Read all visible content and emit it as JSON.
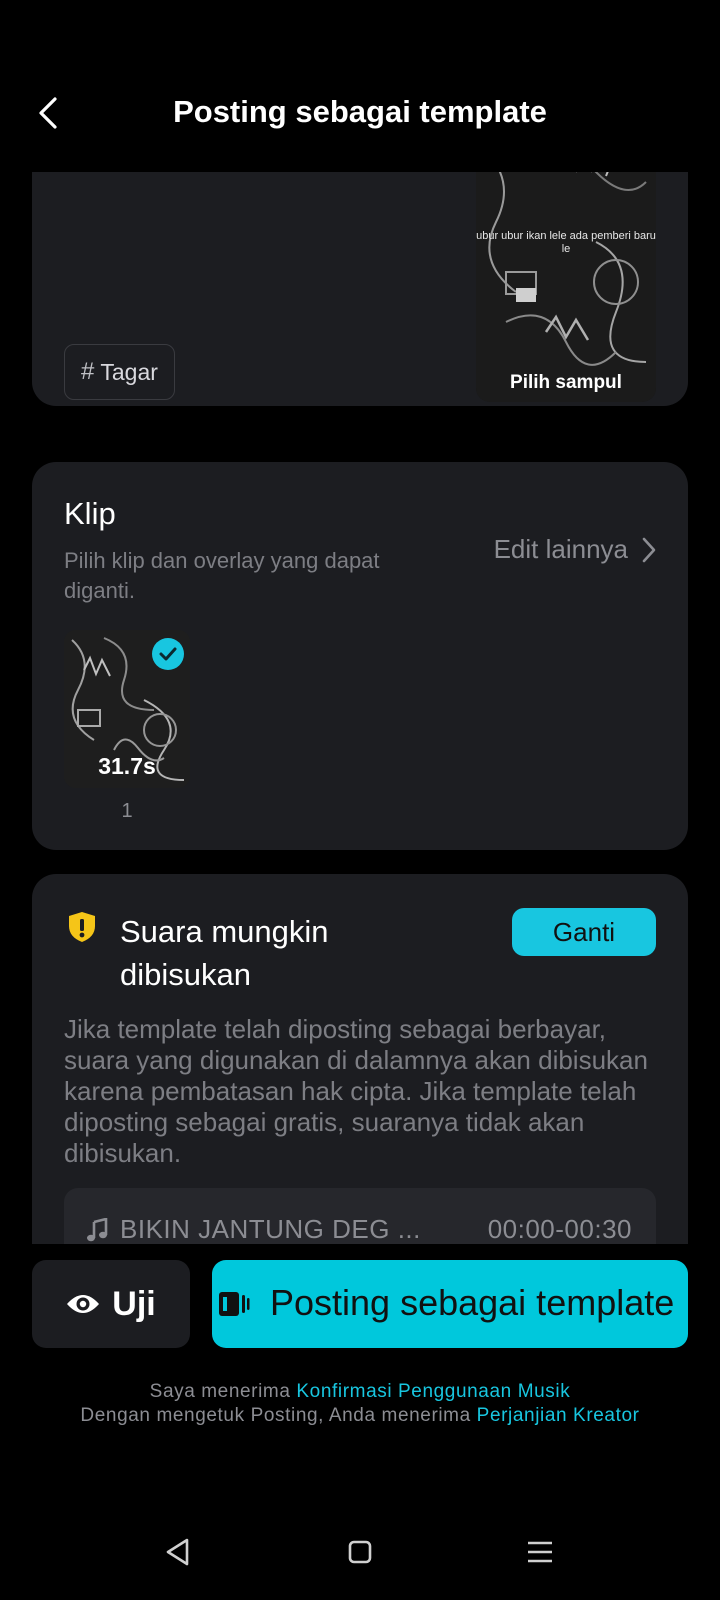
{
  "header": {
    "title": "Posting sebagai template"
  },
  "details": {
    "hashtag_label": "Tagar",
    "cover_text": "ubur ubur ikan lele ada pemberi baru le",
    "cover_label": "Pilih sampul"
  },
  "clips": {
    "title": "Klip",
    "description": "Pilih klip dan overlay yang dapat diganti.",
    "edit_more": "Edit lainnya",
    "items": [
      {
        "duration": "31.7s",
        "index": "1",
        "selected": true
      }
    ]
  },
  "audio_warning": {
    "title": "Suara mungkin dibisukan",
    "change_button": "Ganti",
    "body": "Jika template telah diposting sebagai berbayar, suara yang digunakan di dalamnya akan dibisukan karena pembatasan hak cipta. Jika template telah diposting sebagai gratis, suaranya tidak akan dibisukan.",
    "track_name": "BIKIN JANTUNG DEG ...",
    "track_time": "00:00-00:30",
    "accent_color": "#f5c518"
  },
  "actions": {
    "test_label": "Uji",
    "post_label": "Posting sebagai template",
    "accent_color": "#00c8dc"
  },
  "consent": {
    "line1_prefix": "Saya menerima ",
    "line1_link": "Konfirmasi Penggunaan Musik",
    "line2_prefix": "Dengan mengetuk Posting, Anda menerima ",
    "line2_link": "Perjanjian Kreator"
  },
  "icons": {
    "back": "chevron-left-icon",
    "hashtag": "hashtag-icon",
    "chevron": "chevron-right-icon",
    "check": "check-circle-icon",
    "warning": "shield-alert-icon",
    "music": "music-note-icon",
    "eye": "eye-icon",
    "video": "video-template-icon"
  }
}
